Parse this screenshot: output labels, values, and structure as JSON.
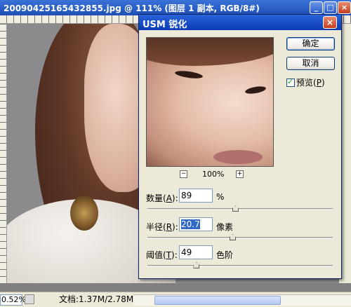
{
  "document": {
    "title": "20090425165432855.jpg @ 111% (图层 1 副本, RGB/8#)",
    "zoom": "0.52%",
    "doc_size": "文档:1.37M/2.78M"
  },
  "dialog": {
    "title": "USM 锐化",
    "close": "×",
    "ok_label": "确定",
    "cancel_label": "取消",
    "preview_label_pre": "预览(",
    "preview_label_key": "P",
    "preview_label_post": ")",
    "preview_checked": true,
    "zoom_out": "−",
    "zoom_level": "100%",
    "zoom_in": "+",
    "amount": {
      "label_pre": "数量(",
      "label_key": "A",
      "label_post": "):",
      "value": "89",
      "unit": "%",
      "slider_fraction": 0.477
    },
    "radius": {
      "label_pre": "半径(",
      "label_key": "R",
      "label_post": "):",
      "value": "20.7",
      "unit": "像素",
      "slider_fraction": 0.462
    },
    "threshold": {
      "label_pre": "阈值(",
      "label_key": "T",
      "label_post": "):",
      "value": "49",
      "unit": "色阶",
      "slider_fraction": 0.267
    }
  },
  "colors": {
    "title_bar": "#1f4fb5",
    "dialog_bg": "#ece9d8",
    "selection": "#316ac5"
  },
  "icons": [
    "minimize-icon",
    "maximize-icon",
    "close-icon",
    "check-icon",
    "zoom-out-icon",
    "zoom-in-icon",
    "slider-thumb-icon"
  ]
}
